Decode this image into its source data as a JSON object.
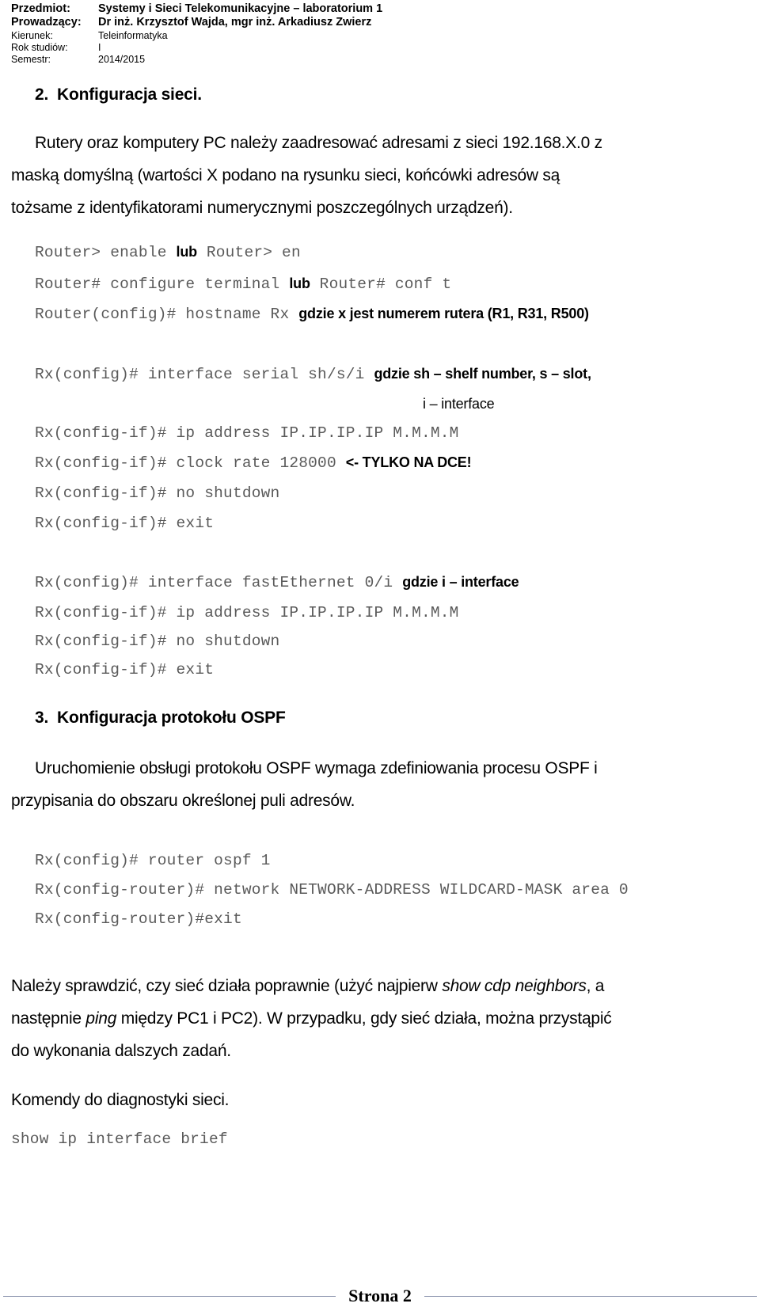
{
  "header": {
    "rows": [
      {
        "label": "Przedmiot:",
        "value": "Systemy i Sieci Telekomunikacyjne – laboratorium 1"
      },
      {
        "label": "Prowadzący:",
        "value": "Dr inż. Krzysztof Wajda, mgr inż. Arkadiusz Zwierz"
      },
      {
        "label": "Kierunek:",
        "value": "Teleinformatyka"
      },
      {
        "label": "Rok studiów:",
        "value": "I"
      },
      {
        "label": "Semestr:",
        "value": "2014/2015"
      }
    ]
  },
  "sections": {
    "network_config": {
      "number": "2.",
      "title": "Konfiguracja sieci.",
      "paragraph_line1": "Rutery oraz komputery PC należy zaadresować adresami z sieci 192.168.X.0 z",
      "paragraph_line2": "maską domyślną (wartości X podano na rysunku sieci, końcówki adresów są",
      "paragraph_line3": "tożsame z identyfikatorami numerycznymi poszczególnych urządzeń)."
    },
    "ospf_config": {
      "number": "3.",
      "title": "Konfiguracja protokołu OSPF",
      "paragraph_line1": "Uruchomienie obsługi protokołu OSPF wymaga zdefiniowania procesu OSPF i",
      "paragraph_line2": "przypisania do obszaru określonej puli adresów."
    }
  },
  "commands": {
    "enable": {
      "cmd_a": "Router> enable ",
      "sep": "lub",
      "cmd_b": " Router> en"
    },
    "configure": {
      "cmd_a": "Router# configure terminal ",
      "sep": "lub",
      "cmd_b": " Router# conf t"
    },
    "hostname": {
      "cmd": "Router(config)# hostname Rx ",
      "note": "gdzie x jest numerem rutera (R1, R31, R500)"
    },
    "interface_serial": {
      "cmd": "Rx(config)# interface serial sh/s/i ",
      "note": "gdzie sh – shelf number, s – slot,",
      "note_cont": "i – interface"
    },
    "ip_address_serial": {
      "cmd": "Rx(config-if)# ip address IP.IP.IP.IP M.M.M.M"
    },
    "clock_rate": {
      "cmd": "Rx(config-if)# clock rate 128000 ",
      "note": "<- TYLKO NA DCE!"
    },
    "no_shutdown_serial": {
      "cmd": "Rx(config-if)# no shutdown"
    },
    "exit_serial": {
      "cmd": "Rx(config-if)# exit"
    },
    "interface_fastethernet": {
      "cmd": "Rx(config)# interface fastEthernet 0/i ",
      "note": "gdzie i – interface"
    },
    "ip_address_fa": {
      "cmd": "Rx(config-if)# ip address IP.IP.IP.IP M.M.M.M"
    },
    "no_shutdown_fa": {
      "cmd": "Rx(config-if)# no shutdown"
    },
    "exit_fa": {
      "cmd": "Rx(config-if)# exit"
    },
    "router_ospf": {
      "cmd": "Rx(config)# router ospf 1"
    },
    "network_statement": {
      "cmd": "Rx(config-router)# network NETWORK-ADDRESS WILDCARD-MASK area 0"
    },
    "exit_router": {
      "cmd": "Rx(config-router)#exit"
    },
    "show_ip_interface_brief": {
      "cmd": "show ip interface brief"
    }
  },
  "verification": {
    "line1_a": "Należy sprawdzić, czy sieć działa poprawnie (użyć najpierw ",
    "line1_italic": "show cdp neighbors",
    "line1_b": ", a",
    "line2_a": "następnie ",
    "line2_italic": "ping",
    "line2_b": " między PC1 i PC2). W przypadku, gdy sieć działa, można przystąpić",
    "line3": "do wykonania dalszych zadań."
  },
  "diagnostics": {
    "heading": "Komendy do diagnostyki sieci."
  },
  "footer": {
    "page_label": "Strona 2"
  },
  "colors": {
    "text": "#000000",
    "mono_text": "#5a5a5a",
    "footer_rule": "#8a93ad",
    "background": "#ffffff"
  }
}
